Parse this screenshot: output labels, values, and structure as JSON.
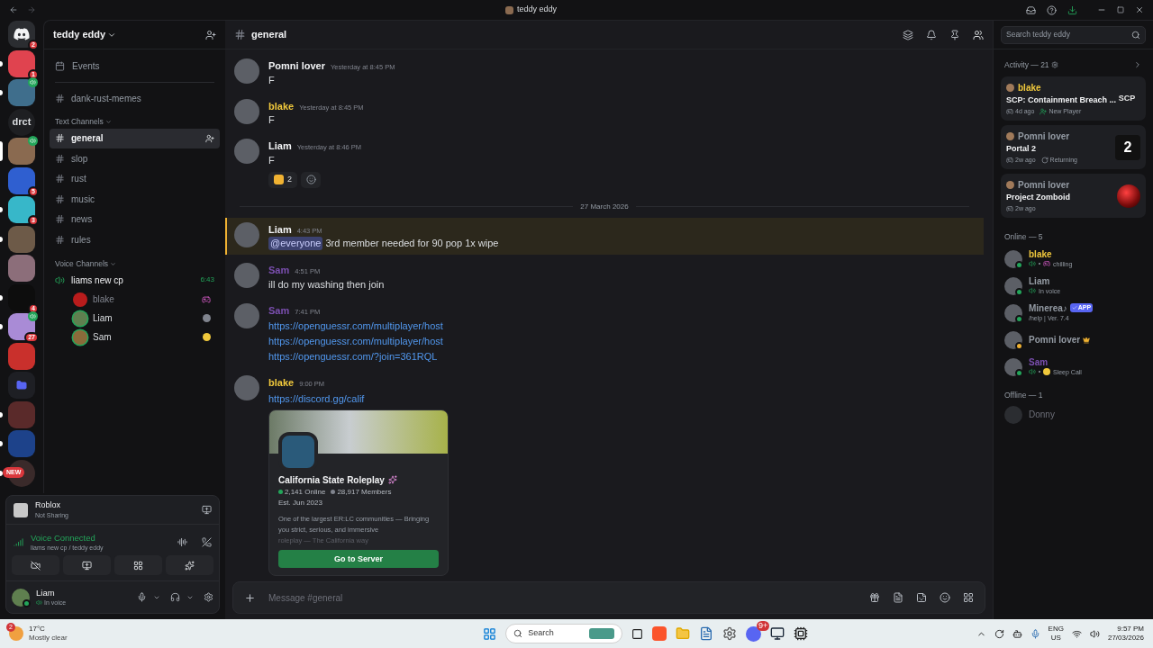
{
  "window": {
    "title": "teddy eddy"
  },
  "servers": [
    {
      "kind": "home",
      "badge": "2",
      "unread": false,
      "selected": false,
      "voice": false,
      "color": "#2b2d31"
    },
    {
      "kind": "image",
      "badge": "1",
      "unread": true,
      "selected": false,
      "voice": false,
      "color": "#e0434f"
    },
    {
      "kind": "image",
      "unread": true,
      "selected": false,
      "voice": true,
      "color": "#3f6e8c"
    },
    {
      "kind": "text",
      "label": "drct",
      "unread": false,
      "selected": false,
      "voice": false,
      "color": "#1e1f22"
    },
    {
      "kind": "image",
      "unread": false,
      "selected": true,
      "voice": true,
      "color": "#8a6a50"
    },
    {
      "kind": "image",
      "badge": "5",
      "unread": false,
      "selected": false,
      "voice": false,
      "color": "#2f5fd0"
    },
    {
      "kind": "image",
      "badge": "3",
      "unread": true,
      "selected": false,
      "voice": false,
      "color": "#37b7c9"
    },
    {
      "kind": "image",
      "unread": true,
      "selected": false,
      "voice": false,
      "color": "#6d5a48"
    },
    {
      "kind": "image",
      "unread": false,
      "selected": false,
      "voice": false,
      "color": "#8c6e7a"
    },
    {
      "kind": "image",
      "badge": "4",
      "unread": true,
      "selected": false,
      "voice": false,
      "color": "#0d0d0d"
    },
    {
      "kind": "image",
      "badge": "27",
      "unread": true,
      "selected": false,
      "voice": true,
      "color": "#a98bd6"
    },
    {
      "kind": "image",
      "unread": false,
      "selected": false,
      "voice": false,
      "color": "#c9302c"
    },
    {
      "kind": "folder",
      "unread": false,
      "selected": false,
      "voice": false,
      "color": "#5865f2"
    },
    {
      "kind": "image",
      "unread": true,
      "selected": false,
      "voice": false,
      "color": "#5a2a2a"
    },
    {
      "kind": "image",
      "unread": true,
      "selected": false,
      "voice": false,
      "color": "#1d428a"
    },
    {
      "kind": "new",
      "label": "NEW",
      "unread": true,
      "selected": false,
      "voice": false,
      "color": "#3a2a2a"
    }
  ],
  "sidebar": {
    "server_name": "teddy eddy",
    "events": "Events",
    "channels": [
      {
        "name": "dank-rust-memes",
        "selected": false
      }
    ],
    "text_category": "Text Channels",
    "text_channels": [
      {
        "name": "general",
        "selected": true
      },
      {
        "name": "slop",
        "selected": false
      },
      {
        "name": "rust",
        "selected": false
      },
      {
        "name": "music",
        "selected": false
      },
      {
        "name": "news",
        "selected": false
      },
      {
        "name": "rules",
        "selected": false
      }
    ],
    "voice_category": "Voice Channels",
    "voice_channel": {
      "name": "liams new cp",
      "timer": "6:43",
      "members": [
        {
          "name": "blake",
          "color": "#b91c1c",
          "kind": "game",
          "speaking": false
        },
        {
          "name": "Liam",
          "color": "#5f7f4f",
          "kind": "muted",
          "speaking": true
        },
        {
          "name": "Sam",
          "color": "#8a6a3a",
          "kind": "emoji",
          "speaking": true
        }
      ]
    }
  },
  "panel": {
    "activity": {
      "title": "Roblox",
      "subtitle": "Not Sharing"
    },
    "voice": {
      "status": "Voice Connected",
      "location": "liams new cp / teddy eddy"
    },
    "user": {
      "name": "Liam",
      "status": "In voice",
      "color": "#5f7f4f"
    }
  },
  "header": {
    "channel": "general"
  },
  "search": {
    "placeholder": "Search teddy eddy"
  },
  "messages": [
    {
      "kind": "message",
      "author": "Pomni lover",
      "color": "#f2f3f5",
      "time": "Yesterday at 8:45 PM",
      "highlighted": false,
      "lines": [
        {
          "kind": "text",
          "text": "F"
        }
      ]
    },
    {
      "kind": "message",
      "author": "blake",
      "color": "#f0c83c",
      "time": "Yesterday at 8:45 PM",
      "highlighted": false,
      "lines": [
        {
          "kind": "text",
          "text": "F"
        }
      ]
    },
    {
      "kind": "message",
      "author": "Liam",
      "color": "#f2f3f5",
      "time": "Yesterday at 8:46 PM",
      "highlighted": false,
      "lines": [
        {
          "kind": "text",
          "text": "F"
        }
      ],
      "reactions": [
        {
          "count": "2"
        }
      ]
    },
    {
      "kind": "divider",
      "text": "27 March 2026"
    },
    {
      "kind": "message",
      "author": "Liam",
      "color": "#f2f3f5",
      "time": "4:43 PM",
      "highlighted": true,
      "lines": [
        {
          "kind": "mention",
          "mention": "@everyone",
          "text": "3rd member needed for 90 pop 1x wipe"
        }
      ]
    },
    {
      "kind": "message",
      "author": "Sam",
      "color": "#7b4fb0",
      "time": "4:51 PM",
      "highlighted": false,
      "lines": [
        {
          "kind": "text",
          "text": "ill do my washing then join"
        }
      ]
    },
    {
      "kind": "message",
      "author": "Sam",
      "color": "#7b4fb0",
      "time": "7:41 PM",
      "highlighted": false,
      "lines": [
        {
          "kind": "link",
          "text": "https://openguessr.com/multiplayer/host"
        },
        {
          "kind": "link",
          "text": "https://openguessr.com/multiplayer/host"
        },
        {
          "kind": "link",
          "text": "https://openguessr.com/?join=361RQL"
        }
      ]
    },
    {
      "kind": "message",
      "author": "blake",
      "color": "#f0c83c",
      "time": "9:00 PM",
      "highlighted": false,
      "lines": [
        {
          "kind": "link",
          "text": "https://discord.gg/calif"
        }
      ],
      "invite": {
        "title": "California State Roleplay",
        "online": "2,141 Online",
        "members": "28,917 Members",
        "established": "Est. Jun 2023",
        "description": "One of the largest ER:LC communities — Bringing you strict, serious, and immersive",
        "description_faded": "roleplay — The California way",
        "button": "Go to Server"
      }
    }
  ],
  "composer": {
    "placeholder": "Message #general"
  },
  "activity": {
    "heading": "Activity — 21",
    "cards": [
      {
        "user": "blake",
        "color": "#f0c83c",
        "game": "SCP: Containment Breach ...",
        "time": "4d ago",
        "tag": {
          "kind": "new",
          "text": "New Player"
        },
        "thumb": {
          "kind": "scp",
          "label": "SCP"
        }
      },
      {
        "user": "Pomni lover",
        "color": "#949ba4",
        "game": "Portal 2",
        "time": "2w ago",
        "tag": {
          "kind": "returning",
          "text": "Returning"
        },
        "thumb": {
          "kind": "tile",
          "label": "2"
        }
      },
      {
        "user": "Pomni lover",
        "color": "#949ba4",
        "game": "Project Zomboid",
        "time": "2w ago",
        "thumb": {
          "kind": "orb"
        }
      }
    ]
  },
  "online_heading": "Online — 5",
  "members": [
    {
      "name": "blake",
      "color": "#f0c83c",
      "idle": false,
      "kind": "voice_activity",
      "detail": "chilling"
    },
    {
      "name": "Liam",
      "color": "#949ba4",
      "idle": false,
      "kind": "voice",
      "detail": "In voice"
    },
    {
      "name": "Minerea♪",
      "color": "#949ba4",
      "idle": false,
      "kind": "bot",
      "tag": "APP",
      "detail": "/help | Ver. 7.4"
    },
    {
      "name": "Pomni lover",
      "color": "#949ba4",
      "idle": true,
      "kind": "owner"
    },
    {
      "name": "Sam",
      "color": "#7b4fb0",
      "idle": false,
      "kind": "voice_emoji",
      "detail": "Sleep Call"
    }
  ],
  "offline_heading": "Offline — 1",
  "offline": [
    {
      "name": "Donny"
    }
  ],
  "taskbar": {
    "temp": "17°C",
    "weather": "Mostly clear",
    "weather_badge": "2",
    "search": "Search",
    "discord_badge": "9+",
    "lang": "ENG",
    "region": "US",
    "time": "9:57 PM",
    "date": "27/03/2026"
  }
}
